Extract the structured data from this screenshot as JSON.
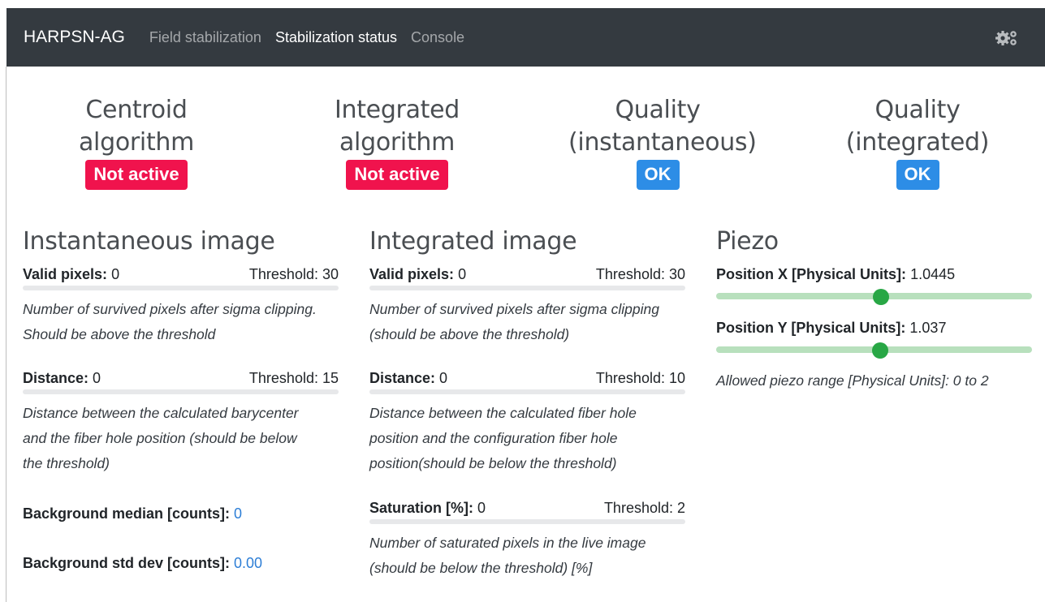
{
  "nav": {
    "brand": "HARPSN-AG",
    "links": [
      {
        "label": "Field stabilization",
        "active": false
      },
      {
        "label": "Stabilization status",
        "active": true
      },
      {
        "label": "Console",
        "active": false
      }
    ],
    "settings_icon": "gears-icon"
  },
  "status": {
    "centroid": {
      "title": "Centroid algorithm",
      "badge": "Not active",
      "color": "#f0134d"
    },
    "integrated": {
      "title_line1": "Integrated",
      "title_line2": "algorithm",
      "badge": "Not active",
      "color": "#f0134d"
    },
    "quality_inst": {
      "title_line1": "Quality",
      "title_line2": "(instantaneous)",
      "badge": "OK",
      "color": "#2d8de6"
    },
    "quality_int": {
      "title": "Quality (integrated)",
      "badge": "OK",
      "color": "#2d8de6"
    }
  },
  "instantaneous": {
    "title": "Instantaneous image",
    "valid_pixels": {
      "label": "Valid pixels:",
      "value": "0",
      "threshold": "Threshold: 30",
      "desc": "Number of survived pixels after sigma clipping. Should be above the threshold"
    },
    "distance": {
      "label": "Distance:",
      "value": "0",
      "threshold": "Threshold: 15",
      "desc": "Distance between the calculated barycenter and the fiber hole position (should be below the threshold)"
    },
    "bg_median": {
      "label": "Background median [counts]:",
      "value": "0"
    },
    "bg_std": {
      "label": "Background std dev [counts]:",
      "value": "0.00"
    }
  },
  "integrated_img": {
    "title": "Integrated image",
    "valid_pixels": {
      "label": "Valid pixels:",
      "value": "0",
      "threshold": "Threshold: 30",
      "desc": "Number of survived pixels after sigma clipping (should be above the threshold)"
    },
    "distance": {
      "label": "Distance:",
      "value": "0",
      "threshold": "Threshold: 10",
      "desc": "Distance between the calculated fiber hole position and the configuration fiber hole position(should be below the threshold)"
    },
    "saturation": {
      "label": "Saturation [%]:",
      "value": "0",
      "threshold": "Threshold: 2",
      "desc": "Number of saturated pixels in the live image (should be below the threshold) [%]"
    }
  },
  "piezo": {
    "title": "Piezo",
    "pos_x": {
      "label": "Position X [Physical Units]:",
      "value": "1.0445",
      "fraction": 0.522
    },
    "pos_y": {
      "label": "Position Y [Physical Units]:",
      "value": "1.037",
      "fraction": 0.518
    },
    "range_note": "Allowed piezo range [Physical Units]: 0 to 2"
  }
}
